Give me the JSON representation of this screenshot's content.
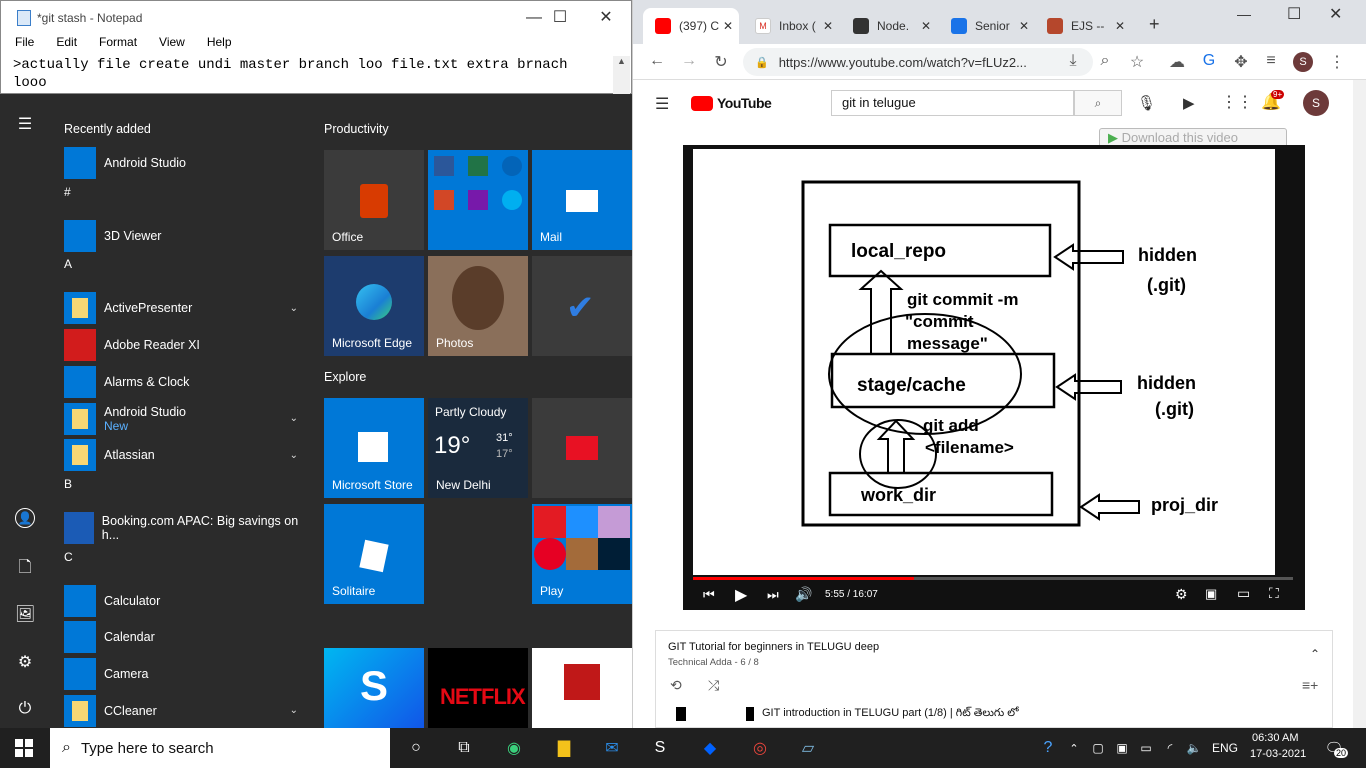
{
  "notepad": {
    "title": "*git stash - Notepad",
    "menu": [
      "File",
      "Edit",
      "Format",
      "View",
      "Help"
    ],
    "text": ">actually file create undi master branch loo file.txt extra brnach looo\navailable undi"
  },
  "start_menu": {
    "recently_added_label": "Recently added",
    "apps": [
      {
        "label": "Android Studio",
        "color": "#0078d7"
      },
      {
        "header": "#"
      },
      {
        "label": "3D Viewer",
        "color": "#0078d7"
      },
      {
        "header": "A"
      },
      {
        "label": "ActivePresenter",
        "color": "#0078d7",
        "folder": true
      },
      {
        "label": "Adobe Reader XI",
        "color": "#d21c1c"
      },
      {
        "label": "Alarms & Clock",
        "color": "#0078d7"
      },
      {
        "label": "Android Studio",
        "sub": "New",
        "color": "#0078d7",
        "folder": true
      },
      {
        "label": "Atlassian",
        "color": "#0078d7",
        "folder": true
      },
      {
        "header": "B"
      },
      {
        "label": "Booking.com APAC: Big savings on h...",
        "color": "#1b5bb5"
      },
      {
        "header": "C"
      },
      {
        "label": "Calculator",
        "color": "#0078d7"
      },
      {
        "label": "Calendar",
        "color": "#0078d7"
      },
      {
        "label": "Camera",
        "color": "#0078d7"
      },
      {
        "label": "CCleaner",
        "color": "#0078d7",
        "folder": true
      }
    ],
    "groups": {
      "productivity": "Productivity",
      "explore": "Explore"
    },
    "tiles": {
      "office": "Office",
      "mail": "Mail",
      "edge": "Microsoft Edge",
      "photos": "Photos",
      "store": "Microsoft Store",
      "weather_title": "Partly Cloudy",
      "weather_temp": "19°",
      "weather_high": "31°",
      "weather_low": "17°",
      "weather_city": "New Delhi",
      "solitaire": "Solitaire",
      "play": "Play",
      "netflix": "NETFLIX"
    }
  },
  "chrome": {
    "tabs": [
      {
        "label": "(397) C",
        "color": "#ff0000"
      },
      {
        "label": "Inbox (",
        "color": "#ffffff"
      },
      {
        "label": "Node.",
        "color": "#333333"
      },
      {
        "label": "Senior",
        "color": "#1a73e8"
      },
      {
        "label": "EJS --",
        "color": "#b5472c"
      }
    ],
    "url": "https://www.youtube.com/watch?v=fLUz2...",
    "profile": "S"
  },
  "youtube": {
    "logo": "YouTube",
    "search_query": "git in telugue",
    "notif_count": "9+",
    "download_label": "Download this video",
    "video_time": "5:55 / 16:07",
    "progress": 0.368,
    "diagram": {
      "local_repo": "local_repo",
      "commit_cmd": "git commit -m",
      "commit_msg1": "\"commit",
      "commit_msg2": "message\"",
      "stage": "stage/cache",
      "add1": "git add",
      "add2": "<filename>",
      "work": "work_dir",
      "hidden": "hidden",
      "dotgit": "(.git)",
      "proj": "proj_dir"
    },
    "playlist_title": "GIT Tutorial for beginners in TELUGU deep",
    "playlist_sub": "Technical Adda - 6 / 8",
    "playlist_item": "GIT introduction in TELUGU part (1/8) | గిట్ తెలుగు లో"
  },
  "taskbar": {
    "search_placeholder": "Type here to search",
    "lang": "ENG",
    "time": "06:30 AM",
    "date": "17-03-2021",
    "notif": "20"
  }
}
